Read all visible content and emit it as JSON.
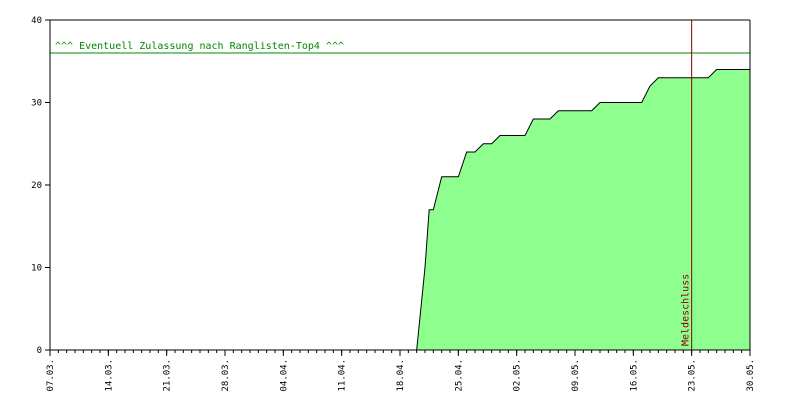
{
  "chart_data": {
    "type": "area",
    "title": "",
    "xlabel": "",
    "ylabel": "",
    "ylim": [
      0,
      40
    ],
    "y_ticks": [
      "0",
      "10",
      "20",
      "30",
      "40"
    ],
    "x_ticks": [
      "07.03.",
      "14.03.",
      "21.03.",
      "28.03.",
      "04.04.",
      "11.04.",
      "18.04.",
      "25.04.",
      "02.05.",
      "09.05.",
      "16.05.",
      "23.05.",
      "30.05."
    ],
    "grid": false,
    "series": [
      {
        "values": [
          {
            "x": "20.04.",
            "y": 0
          },
          {
            "x": "21.04.",
            "y": 10
          },
          {
            "x": "21.04.",
            "y": 17
          },
          {
            "x": "22.04.",
            "y": 17
          },
          {
            "x": "23.04.",
            "y": 21
          },
          {
            "x": "24.04.",
            "y": 21
          },
          {
            "x": "25.04.",
            "y": 21
          },
          {
            "x": "26.04.",
            "y": 24
          },
          {
            "x": "27.04.",
            "y": 24
          },
          {
            "x": "28.04.",
            "y": 25
          },
          {
            "x": "29.04.",
            "y": 25
          },
          {
            "x": "30.04.",
            "y": 26
          },
          {
            "x": "01.05.",
            "y": 26
          },
          {
            "x": "02.05.",
            "y": 26
          },
          {
            "x": "03.05.",
            "y": 26
          },
          {
            "x": "04.05.",
            "y": 28
          },
          {
            "x": "05.05.",
            "y": 28
          },
          {
            "x": "06.05.",
            "y": 28
          },
          {
            "x": "07.05.",
            "y": 29
          },
          {
            "x": "08.05.",
            "y": 29
          },
          {
            "x": "09.05.",
            "y": 29
          },
          {
            "x": "10.05.",
            "y": 29
          },
          {
            "x": "11.05.",
            "y": 29
          },
          {
            "x": "12.05.",
            "y": 30
          },
          {
            "x": "13.05.",
            "y": 30
          },
          {
            "x": "14.05.",
            "y": 30
          },
          {
            "x": "15.05.",
            "y": 30
          },
          {
            "x": "16.05.",
            "y": 30
          },
          {
            "x": "17.05.",
            "y": 30
          },
          {
            "x": "18.05.",
            "y": 32
          },
          {
            "x": "19.05.",
            "y": 33
          },
          {
            "x": "20.05.",
            "y": 33
          },
          {
            "x": "21.05.",
            "y": 33
          },
          {
            "x": "22.05.",
            "y": 33
          },
          {
            "x": "23.05.",
            "y": 33
          },
          {
            "x": "24.05.",
            "y": 33
          },
          {
            "x": "25.05.",
            "y": 33
          },
          {
            "x": "26.05.",
            "y": 34
          },
          {
            "x": "27.05.",
            "y": 34
          },
          {
            "x": "28.05.",
            "y": 34
          },
          {
            "x": "29.05.",
            "y": 34
          },
          {
            "x": "30.05.",
            "y": 34
          }
        ]
      }
    ],
    "reference_line": {
      "y": 36,
      "label": "^^^ Eventuell Zulassung nach Ranglisten-Top4 ^^^"
    },
    "vertical_marker": {
      "x": "23.05.",
      "label": "Meldeschluss"
    },
    "colors": {
      "fill": "#8eff8e",
      "stroke": "#000000",
      "reference_line": "#008800",
      "vertical_marker": "#880000"
    }
  }
}
